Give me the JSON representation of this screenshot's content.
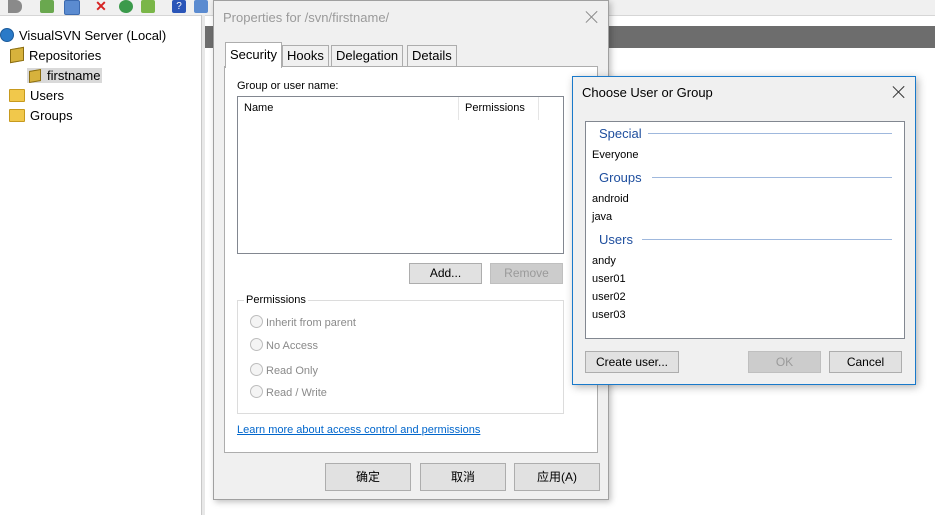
{
  "console": {
    "tree": [
      {
        "label": "VisualSVN Server (Local)",
        "icon": "server-icon"
      },
      {
        "label": "Repositories",
        "icon": "repositories-icon"
      },
      {
        "label": "firstname",
        "icon": "repository-icon"
      },
      {
        "label": "Users",
        "icon": "folder-icon"
      },
      {
        "label": "Groups",
        "icon": "folder-icon"
      }
    ]
  },
  "properties_dialog": {
    "title": "Properties for /svn/firstname/",
    "tabs": [
      "Security",
      "Hooks",
      "Delegation",
      "Details"
    ],
    "group_label": "Group or user name:",
    "columns": [
      "Name",
      "Permissions"
    ],
    "add_button": "Add...",
    "remove_button": "Remove",
    "permissions_legend": "Permissions",
    "permission_options": [
      "Inherit from parent",
      "No Access",
      "Read Only",
      "Read / Write"
    ],
    "learn_link": "Learn more about access control and permissions",
    "ok_button": "确定",
    "cancel_button": "取消",
    "apply_button": "应用(A)"
  },
  "chooser_dialog": {
    "title": "Choose User or Group",
    "sections": [
      {
        "header": "Special",
        "items": [
          "Everyone"
        ]
      },
      {
        "header": "Groups",
        "items": [
          "android",
          "java"
        ]
      },
      {
        "header": "Users",
        "items": [
          "andy",
          "user01",
          "user02",
          "user03"
        ]
      }
    ],
    "create_user_button": "Create user...",
    "ok_button": "OK",
    "cancel_button": "Cancel"
  },
  "colors": {
    "accent_blue": "#1979ca",
    "group_header": "#1e4e9e",
    "link": "#0066cc",
    "dark_bar": "#6d6d6d"
  }
}
